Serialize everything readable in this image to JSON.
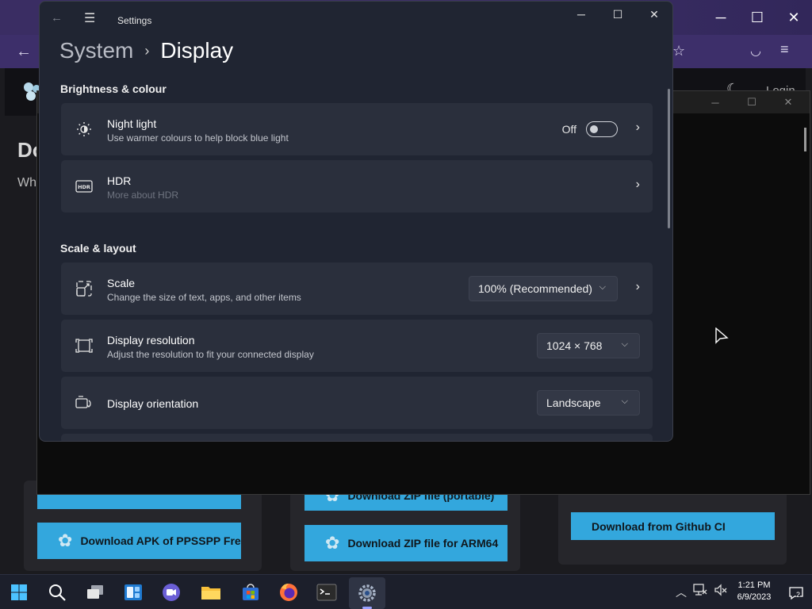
{
  "browser": {
    "win_buttons": [
      "─",
      "☐",
      "✕"
    ],
    "back_glyph": "←",
    "star_glyph": "☆",
    "pocket_glyph": "◡",
    "menu_glyph": "≡",
    "page": {
      "login": "Login",
      "heading_partial": "Do",
      "sub_partial": "Wh"
    },
    "downloads": [
      {
        "label": "Download APK of PPSSPP Free"
      },
      {
        "label": "Download ZIP file for ARM64"
      },
      {
        "label": "Download from Github CI"
      },
      {
        "label": "Download ZIP file (portable)"
      }
    ]
  },
  "settings": {
    "app_title": "Settings",
    "breadcrumb": {
      "parent": "System",
      "separator": "›",
      "current": "Display"
    },
    "win_buttons": [
      "─",
      "☐",
      "✕"
    ],
    "sections": {
      "brightness": "Brightness & colour",
      "scale": "Scale & layout"
    },
    "night_light": {
      "title": "Night light",
      "desc": "Use warmer colours to help block blue light",
      "status": "Off"
    },
    "hdr": {
      "title": "HDR",
      "desc": "More about HDR"
    },
    "scale": {
      "title": "Scale",
      "desc": "Change the size of text, apps, and other items",
      "value": "100% (Recommended)"
    },
    "resolution": {
      "title": "Display resolution",
      "desc": "Adjust the resolution to fit your connected display",
      "value": "1024 × 768"
    },
    "orientation": {
      "title": "Display orientation",
      "value": "Landscape"
    }
  },
  "taskbar": {
    "time": "1:21 PM",
    "date": "6/9/2023",
    "notification_count": "2"
  },
  "colors": {
    "accent": "#33a7dd",
    "settings_bg": "#202532",
    "card_bg": "#2a2f3c"
  }
}
